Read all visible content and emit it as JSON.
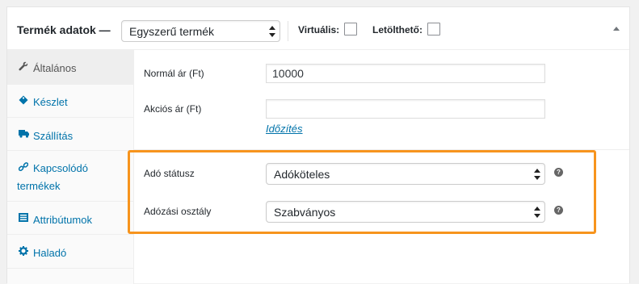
{
  "header": {
    "title": "Termék adatok —",
    "product_type": "Egyszerű termék",
    "virtual_label": "Virtuális:",
    "downloadable_label": "Letölthető:"
  },
  "sidebar": {
    "items": [
      {
        "label": "Általános",
        "icon": "wrench-icon",
        "active": true
      },
      {
        "label": "Készlet",
        "icon": "tag-icon",
        "active": false
      },
      {
        "label": "Szállítás",
        "icon": "truck-icon",
        "active": false
      },
      {
        "label": "Kapcsolódó",
        "label2": "termékek",
        "icon": "link-icon",
        "active": false
      },
      {
        "label": "Attribútumok",
        "icon": "list-icon",
        "active": false
      },
      {
        "label": "Haladó",
        "icon": "gear-icon",
        "active": false
      }
    ]
  },
  "general": {
    "regular_price_label": "Normál ár (Ft)",
    "regular_price_value": "10000",
    "sale_price_label": "Akciós ár (Ft)",
    "sale_price_value": "",
    "schedule_link": "Időzítés",
    "tax_status_label": "Adó státusz",
    "tax_status_value": "Adóköteles",
    "tax_class_label": "Adózási osztály",
    "tax_class_value": "Szabványos",
    "help_glyph": "?"
  },
  "colors": {
    "highlight": "#f7941d",
    "link": "#0073aa"
  }
}
